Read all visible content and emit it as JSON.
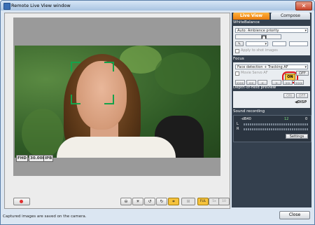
{
  "window": {
    "title": "Remote Live View window"
  },
  "viewer": {
    "formats": [
      "FHD",
      "30.00P",
      "IPB"
    ]
  },
  "toolbar": {
    "buttons": [
      {
        "name": "level-icon",
        "glyph": "⊖"
      },
      {
        "name": "white-balance-icon",
        "glyph": "☀"
      },
      {
        "name": "rotate-left-icon",
        "glyph": "↺"
      },
      {
        "name": "rotate-right-icon",
        "glyph": "↻"
      },
      {
        "name": "af-frame-icon",
        "glyph": "⌗"
      },
      {
        "name": "grid-icon",
        "glyph": "⊞"
      },
      {
        "name": "zoom-fit-icon",
        "glyph": "FUL"
      },
      {
        "name": "zoom-5x-icon",
        "glyph": "5x"
      },
      {
        "name": "zoom-10x-icon",
        "glyph": "10"
      }
    ]
  },
  "tabs": {
    "live_view": "Live View",
    "compose": "Compose"
  },
  "white_balance": {
    "header": "WhiteBalance",
    "mode": "Auto: Ambience priority",
    "apply_label": "Apply to shot images"
  },
  "focus": {
    "header": "Focus",
    "mode": "Face detection + Tracking AF",
    "movie_servo_label": "Movie Servo AF",
    "on_label": "ON",
    "off_label": "OFF",
    "steps": [
      "<<<",
      "<<",
      "<",
      ">",
      ">>",
      ">>>"
    ]
  },
  "dof": {
    "header": "Depth-of-field preview",
    "on_label": "ON",
    "off_label": "OFF"
  },
  "sound": {
    "header": "Sound recording",
    "scale_left": "-dB40",
    "scale_mid": "12",
    "scale_right": "0",
    "l_label": "L",
    "r_label": "R",
    "settings_label": "Settings"
  },
  "status": {
    "message": "Captured images are saved on the camera."
  },
  "buttons": {
    "close": "Close"
  },
  "colors": {
    "accent": "#f5c23c",
    "panel": "#34404e",
    "af_frame": "#15a24a",
    "highlight_ring": "#e0101a"
  }
}
